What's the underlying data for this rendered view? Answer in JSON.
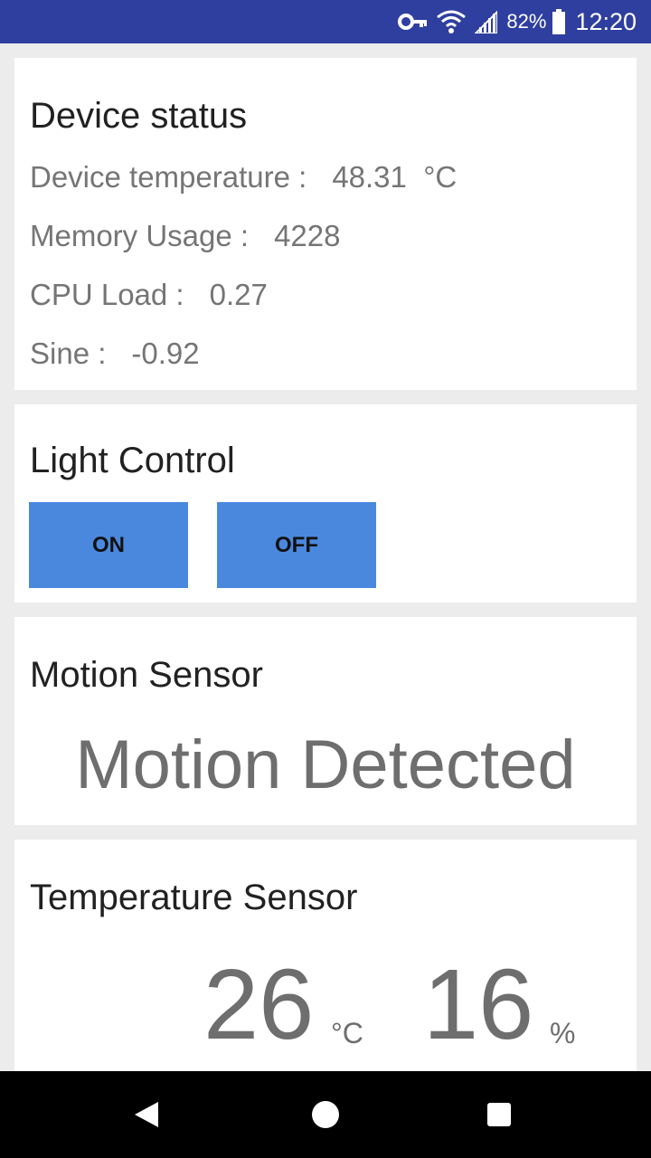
{
  "status_bar": {
    "battery_percent": "82%",
    "time": "12:20",
    "icons": [
      "vpn-key-icon",
      "wifi-icon",
      "signal-icon",
      "battery-icon"
    ],
    "background_color": "#2f3fa0"
  },
  "device_status": {
    "title": "Device status",
    "rows": [
      {
        "label": "Device temperature :",
        "value": "48.31  °C"
      },
      {
        "label": "Memory Usage :",
        "value": "4228"
      },
      {
        "label": "CPU Load :",
        "value": "0.27"
      },
      {
        "label": "Sine :",
        "value": "-0.92"
      }
    ]
  },
  "light_control": {
    "title": "Light Control",
    "on_label": "ON",
    "off_label": "OFF",
    "button_color": "#4a88de"
  },
  "motion_sensor": {
    "title": "Motion Sensor",
    "status": "Motion Detected"
  },
  "temperature_sensor": {
    "title": "Temperature Sensor",
    "temperature": "26",
    "temperature_unit": "°C",
    "humidity": "16",
    "humidity_unit": "%"
  },
  "nav_bar": {
    "icons": [
      "back-icon",
      "home-icon",
      "recents-icon"
    ]
  }
}
